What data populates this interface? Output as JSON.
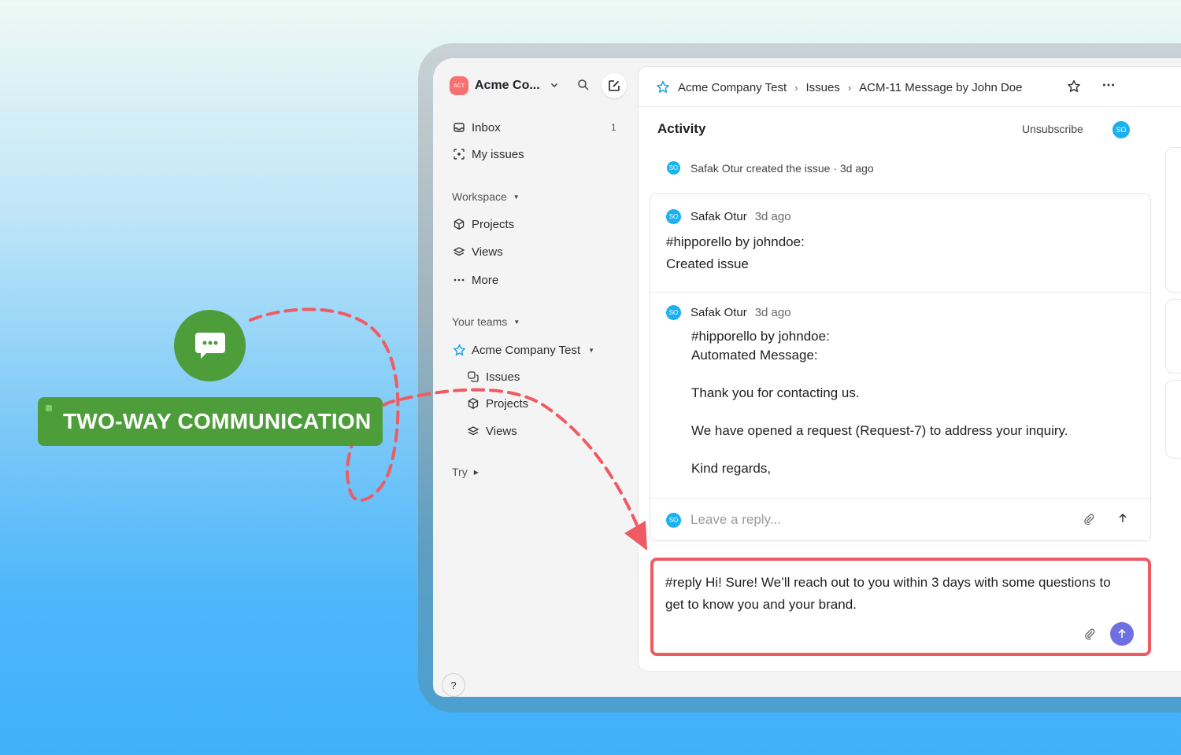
{
  "callout": {
    "label": "TWO-WAY COMMUNICATION",
    "icon": "chat-bubble-icon",
    "color": "#4e9d3b",
    "arrow_color": "#ef5b62"
  },
  "sidebar": {
    "workspace_logo": "ACT",
    "workspace_name": "Acme Co...",
    "nav": [
      {
        "label": "Inbox",
        "count": "1",
        "icon": "inbox-icon"
      },
      {
        "label": "My issues",
        "icon": "target-icon"
      }
    ],
    "workspace_section": "Workspace",
    "workspace_items": [
      {
        "label": "Projects",
        "icon": "cube-icon"
      },
      {
        "label": "Views",
        "icon": "layers-icon"
      },
      {
        "label": "More",
        "icon": "ellipsis-icon"
      }
    ],
    "teams_section": "Your teams",
    "team_name": "Acme Company Test",
    "team_items": [
      {
        "label": "Issues",
        "icon": "issues-icon"
      },
      {
        "label": "Projects",
        "icon": "cube-icon"
      },
      {
        "label": "Views",
        "icon": "layers-icon"
      }
    ],
    "try_section": "Try",
    "help": "?"
  },
  "header": {
    "breadcrumb": [
      "Acme Company Test",
      "Issues",
      "ACM-11 Message by John Doe"
    ]
  },
  "activity": {
    "title": "Activity",
    "unsubscribe": "Unsubscribe",
    "user_initials": "SO",
    "created_event": "Safak Otur created the issue · 3d ago",
    "comments": [
      {
        "author": "Safak Otur",
        "time": "3d ago",
        "text": "#hipporello by johndoe:\nCreated issue"
      },
      {
        "author": "Safak Otur",
        "time": "3d ago",
        "text": "#hipporello by johndoe:\nAutomated Message:\n\nThank you for contacting us.\n\nWe have opened a request (Request-7) to address your inquiry.\n\nKind regards,"
      }
    ],
    "reply_placeholder": "Leave a reply..."
  },
  "composer": {
    "text": "#reply Hi! Sure! We’ll reach out to you within 3 days with some questions to get to know you and your brand."
  }
}
